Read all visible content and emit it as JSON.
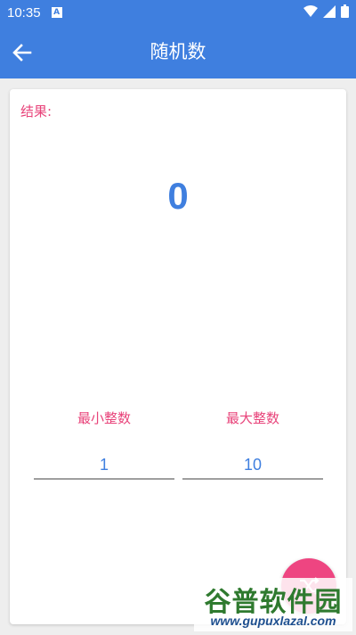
{
  "status_bar": {
    "time": "10:35",
    "notification_icon_letter": "A",
    "icons": [
      "wifi-icon",
      "signal-icon",
      "battery-icon"
    ]
  },
  "app_bar": {
    "title": "随机数",
    "back_icon": "arrow-left-icon"
  },
  "result": {
    "label": "结果:",
    "value": "0"
  },
  "range": {
    "min": {
      "label": "最小整数",
      "value": "1"
    },
    "max": {
      "label": "最大整数",
      "value": "10"
    }
  },
  "fab": {
    "icon": "shuffle-icon"
  },
  "watermark": {
    "main": "谷普软件园",
    "url": "www.gupuxlazal.com"
  },
  "colors": {
    "primary": "#3f7fdf",
    "accent": "#e8437a",
    "fab": "#ee4581"
  }
}
